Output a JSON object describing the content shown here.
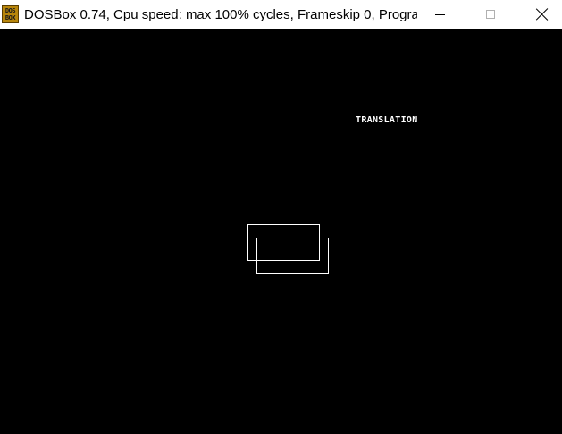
{
  "window": {
    "title": "DOSBox 0.74, Cpu speed: max 100% cycles, Frameskip  0, Progra...",
    "icon": "dosbox-icon",
    "icon_text_top": "DOS",
    "icon_text_bottom": "BOX",
    "controls": {
      "minimize": "minimize-icon",
      "maximize": "maximize-icon",
      "close": "close-icon"
    }
  },
  "screen": {
    "background": "#000000",
    "label": "TRANSLATION",
    "rectangles": [
      {
        "name": "original-rectangle",
        "color": "#ffffff"
      },
      {
        "name": "translated-rectangle",
        "color": "#ffffff"
      }
    ]
  }
}
